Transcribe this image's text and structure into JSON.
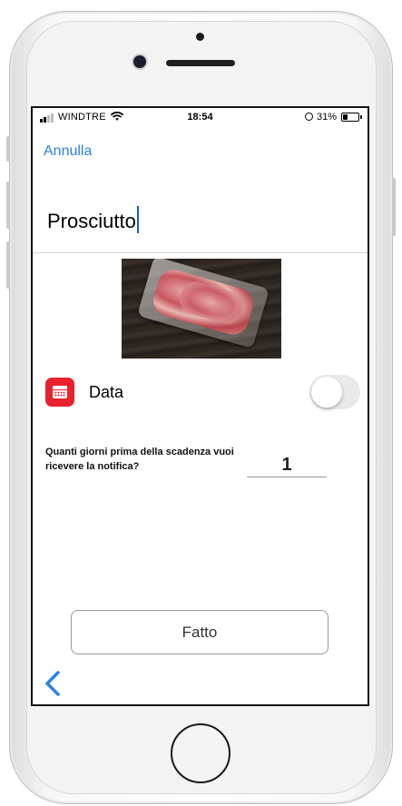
{
  "status_bar": {
    "carrier": "WINDTRE",
    "time": "18:54",
    "battery_percent": "31%",
    "battery_level": 0.31,
    "signal_bars_active": 2,
    "signal_bars_total": 4
  },
  "header": {
    "cancel_label": "Annulla"
  },
  "product": {
    "name": "Prosciutto",
    "image_alt": "packaged prosciutto slices"
  },
  "date_option": {
    "label": "Data",
    "enabled": false,
    "icon": "calendar-icon",
    "icon_color": "#e8232d"
  },
  "notification": {
    "question": "Quanti giorni prima della scadenza vuoi ricevere la notifica?",
    "days_value": "1"
  },
  "actions": {
    "done_label": "Fatto"
  },
  "nav": {
    "back_icon": "chevron-left-icon"
  },
  "colors": {
    "accent": "#2a82e4",
    "caret": "#1a5ad6",
    "toggle_off": "#e9e9eb"
  }
}
